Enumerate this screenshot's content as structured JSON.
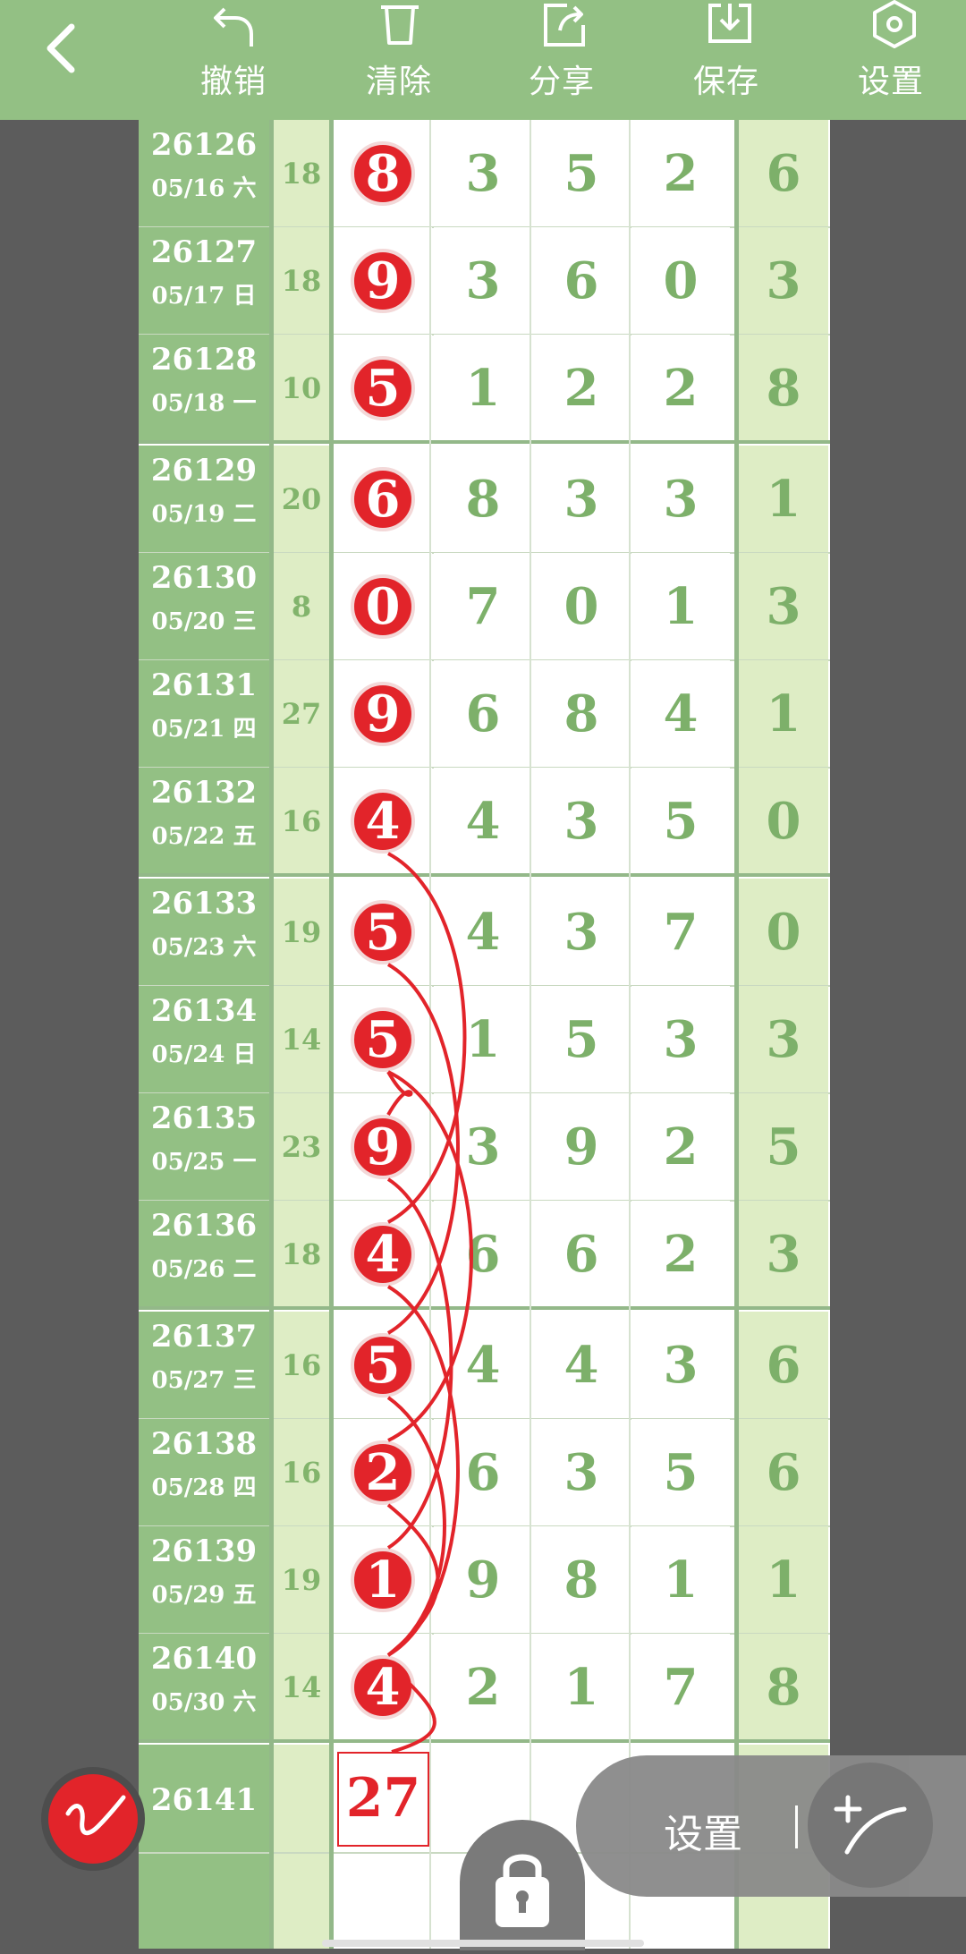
{
  "toolbar": {
    "undo_label": "撤销",
    "clear_label": "清除",
    "share_label": "分享",
    "save_label": "保存",
    "settings_label": "设置"
  },
  "colors": {
    "accent": "#93c084",
    "light": "#deedc5",
    "ball": "#e2242a",
    "digit": "#7db06a"
  },
  "rows": [
    {
      "issue": "26126",
      "date": "05/16 六",
      "sum": "18",
      "d": [
        "8",
        "3",
        "5",
        "2"
      ],
      "last": "6"
    },
    {
      "issue": "26127",
      "date": "05/17 日",
      "sum": "18",
      "d": [
        "9",
        "3",
        "6",
        "0"
      ],
      "last": "3"
    },
    {
      "issue": "26128",
      "date": "05/18 一",
      "sum": "10",
      "d": [
        "5",
        "1",
        "2",
        "2"
      ],
      "last": "8"
    },
    {
      "issue": "26129",
      "date": "05/19 二",
      "sum": "20",
      "d": [
        "6",
        "8",
        "3",
        "3"
      ],
      "last": "1"
    },
    {
      "issue": "26130",
      "date": "05/20 三",
      "sum": "8",
      "d": [
        "0",
        "7",
        "0",
        "1"
      ],
      "last": "3"
    },
    {
      "issue": "26131",
      "date": "05/21 四",
      "sum": "27",
      "d": [
        "9",
        "6",
        "8",
        "4"
      ],
      "last": "1"
    },
    {
      "issue": "26132",
      "date": "05/22 五",
      "sum": "16",
      "d": [
        "4",
        "4",
        "3",
        "5"
      ],
      "last": "0"
    },
    {
      "issue": "26133",
      "date": "05/23 六",
      "sum": "19",
      "d": [
        "5",
        "4",
        "3",
        "7"
      ],
      "last": "0"
    },
    {
      "issue": "26134",
      "date": "05/24 日",
      "sum": "14",
      "d": [
        "5",
        "1",
        "5",
        "3"
      ],
      "last": "3"
    },
    {
      "issue": "26135",
      "date": "05/25 一",
      "sum": "23",
      "d": [
        "9",
        "3",
        "9",
        "2"
      ],
      "last": "5"
    },
    {
      "issue": "26136",
      "date": "05/26 二",
      "sum": "18",
      "d": [
        "4",
        "6",
        "6",
        "2"
      ],
      "last": "3"
    },
    {
      "issue": "26137",
      "date": "05/27 三",
      "sum": "16",
      "d": [
        "5",
        "4",
        "4",
        "3"
      ],
      "last": "6"
    },
    {
      "issue": "26138",
      "date": "05/28 四",
      "sum": "16",
      "d": [
        "2",
        "6",
        "3",
        "5"
      ],
      "last": "6"
    },
    {
      "issue": "26139",
      "date": "05/29 五",
      "sum": "19",
      "d": [
        "1",
        "9",
        "8",
        "1"
      ],
      "last": "1"
    },
    {
      "issue": "26140",
      "date": "05/30 六",
      "sum": "14",
      "d": [
        "4",
        "2",
        "1",
        "7"
      ],
      "last": "8"
    }
  ],
  "next_issue": "26141",
  "prediction": "27",
  "floating": {
    "settings_label": "设置"
  },
  "icons": [
    "back-icon",
    "undo-icon",
    "clear-icon",
    "share-icon",
    "save-icon",
    "settings-icon",
    "pen-icon",
    "lock-icon",
    "add-line-icon"
  ]
}
